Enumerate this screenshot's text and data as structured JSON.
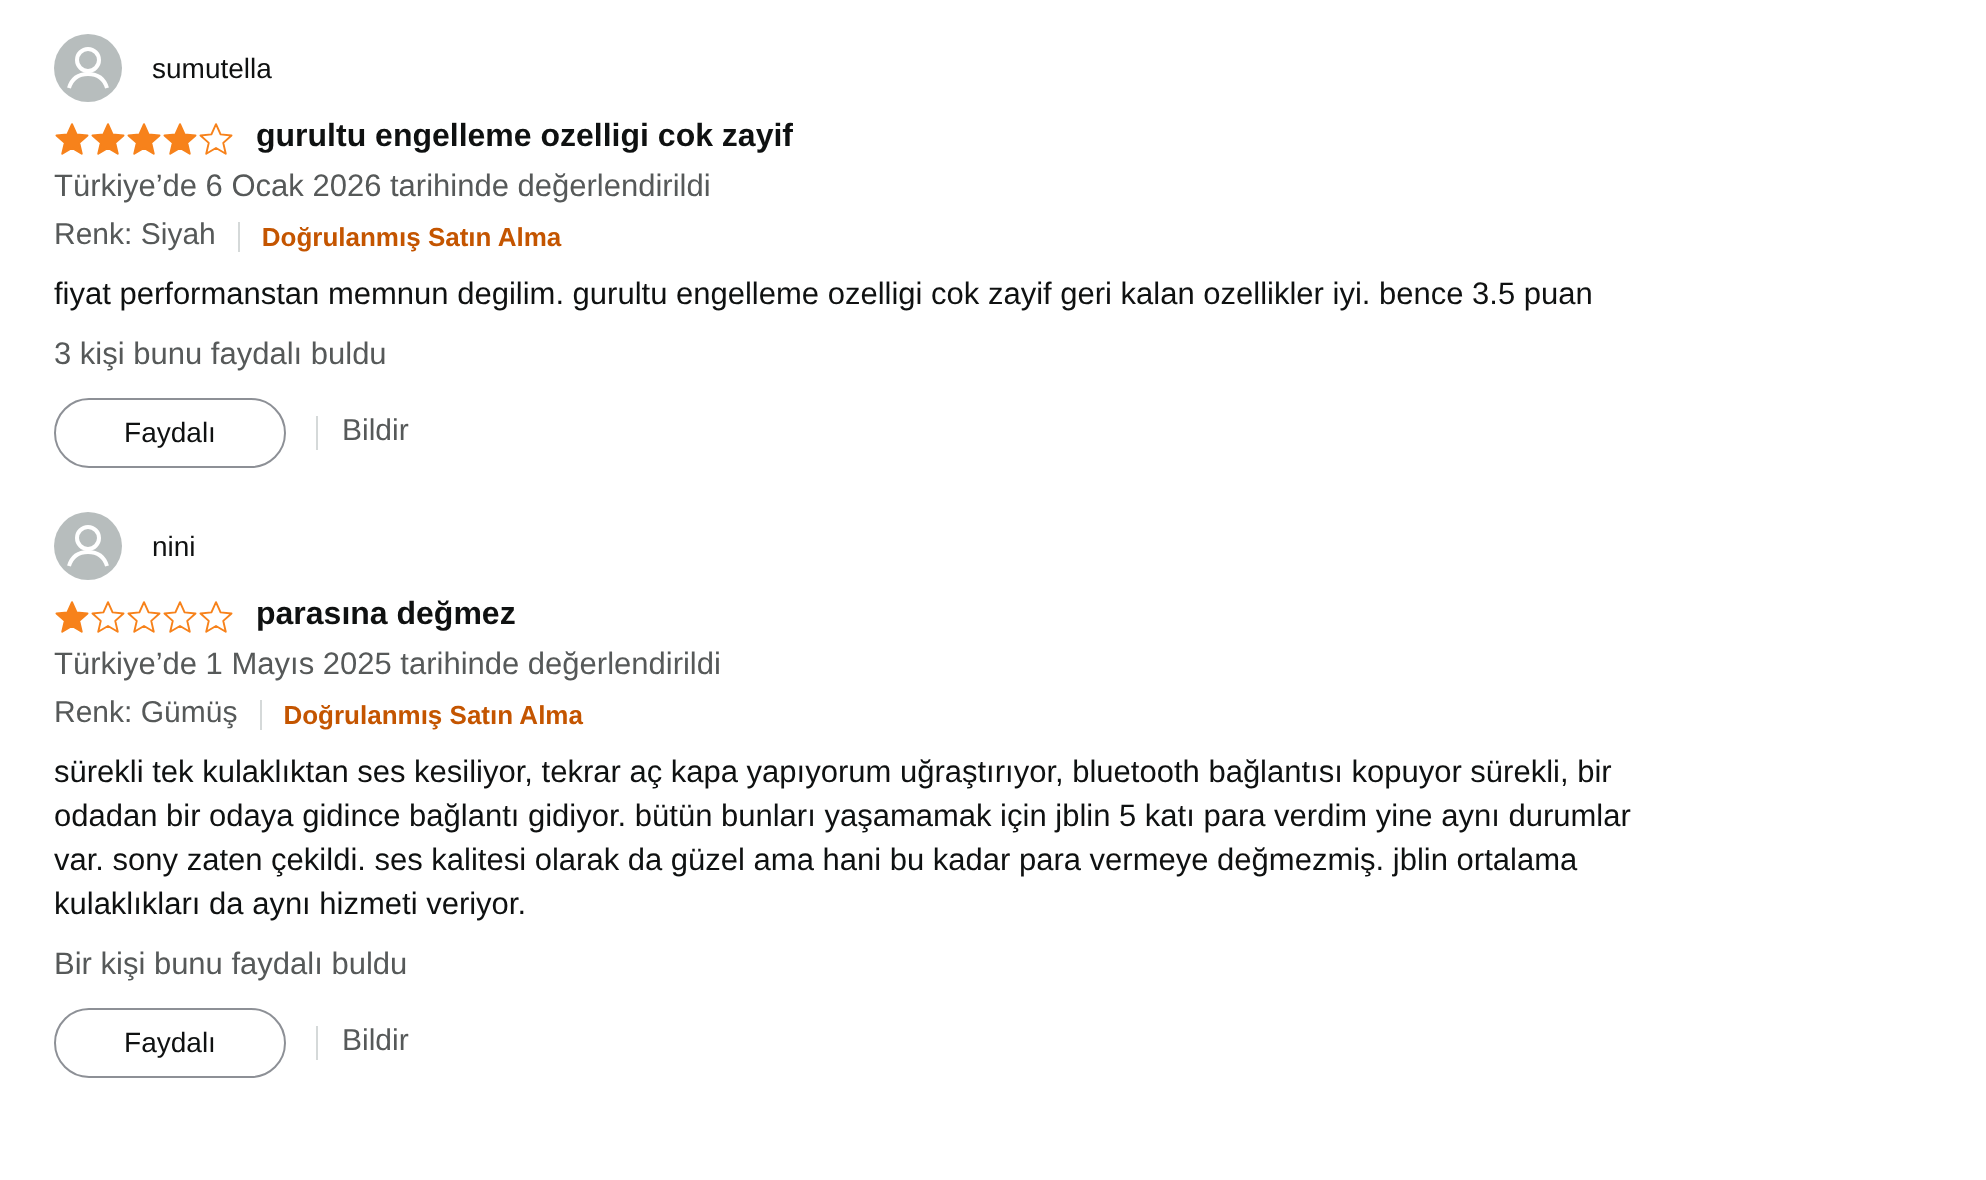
{
  "reviews": [
    {
      "author": "sumutella",
      "stars": 4,
      "title": "gurultu engelleme ozelligi cok zayif",
      "date": "Türkiye’de 6 Ocak 2026 tarihinde değerlendirildi",
      "variant": "Renk: Siyah",
      "verified": "Doğrulanmış Satın Alma",
      "body": "fiyat performanstan memnun degilim. gurultu engelleme ozelligi cok zayif geri kalan ozellikler iyi. bence 3.5 puan",
      "helpful_count": "3 kişi bunu faydalı buldu",
      "helpful_button": "Faydalı",
      "report": "Bildir"
    },
    {
      "author": "nini",
      "stars": 1,
      "title": "parasına değmez",
      "date": "Türkiye’de 1 Mayıs 2025 tarihinde değerlendirildi",
      "variant": "Renk: Gümüş",
      "verified": "Doğrulanmış Satın Alma",
      "body": "sürekli tek kulaklıktan ses kesiliyor, tekrar aç kapa yapıyorum uğraştırıyor, bluetooth bağlantısı kopuyor sürekli, bir odadan bir odaya gidince bağlantı gidiyor. bütün bunları yaşamamak için jblin 5 katı para verdim yine aynı durumlar var. sony zaten çekildi. ses kalitesi olarak da güzel ama hani bu kadar para vermeye değmezmiş. jblin ortalama kulaklıkları da aynı hizmeti veriyor.",
      "helpful_count": "Bir kişi bunu faydalı buldu",
      "helpful_button": "Faydalı",
      "report": "Bildir"
    }
  ]
}
